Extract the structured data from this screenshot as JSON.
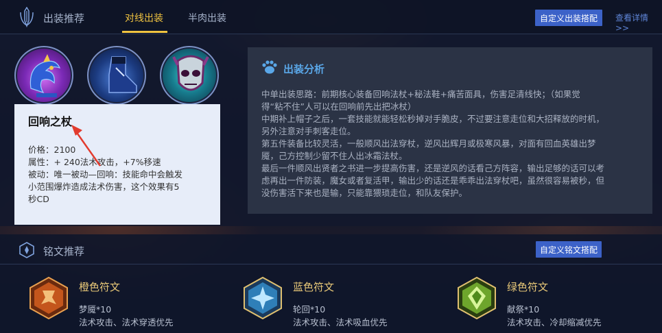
{
  "header": {
    "title": "出装推荐",
    "tabs": [
      {
        "label": "对线出装",
        "active": true
      },
      {
        "label": "半肉出装",
        "active": false
      }
    ],
    "custom_button": "自定义出装搭配",
    "view_details": "查看详情>>"
  },
  "items": [
    {
      "icon": "echo-staff-icon"
    },
    {
      "icon": "boots-icon"
    },
    {
      "icon": "skull-mask-icon"
    }
  ],
  "tooltip": {
    "name": "回响之杖",
    "price": "价格：2100",
    "attr": "属性：+ 240法术攻击，+7%移速",
    "passive_1": "被动：唯一被动—回响：技能命中会触发",
    "passive_2": "小范围爆炸造成法术伤害，这个效果有5",
    "passive_3": "秒CD"
  },
  "analysis": {
    "title": "出装分析",
    "lines": [
      "中单出装思路：前期核心装备回响法杖+秘法鞋+痛苦面具，伤害足清线快；（如果觉",
      "得“粘不住”人可以在回响前先出把冰杖）",
      "中期补上帽子之后，一套技能就能轻松秒掉对手脆皮，不过要注意走位和大招释放的时机，",
      "另外注意对手刺客走位。",
      "第五件装备比较灵活，一般顺风出法穿杖，逆风出辉月或极寒风暴，对面有回血英雄出梦",
      "魇，己方控制少留不住人出冰霜法杖。",
      "最后一件顺风出贤者之书进一步提高伤害，还是逆风的话看己方阵容，输出足够的话可以考",
      "虑再出一件防装，魔女或者复活甲，输出少的话还是乖乖出法穿杖吧，虽然很容易被秒，但",
      "没伤害活下来也是输，只能靠猥琐走位，和队友保护。"
    ]
  },
  "runes": {
    "title": "铭文推荐",
    "custom_button": "自定义铭文搭配",
    "items": [
      {
        "title": "橙色符文",
        "name": "梦魇*10",
        "attr": "法术攻击、法术穿透优先",
        "color": "#d97a2a"
      },
      {
        "title": "蓝色符文",
        "name": "轮回*10",
        "attr": "法术攻击、法术吸血优先",
        "color": "#4fa6d8"
      },
      {
        "title": "绿色符文",
        "name": "献祭*10",
        "attr": "法术攻击、冷却缩减优先",
        "color": "#7fb43a"
      }
    ]
  },
  "colors": {
    "accent_gold": "#f0c340",
    "button_blue": "#3c62c8",
    "link_blue": "#5f86d8",
    "arrow_red": "#e23b2e"
  }
}
